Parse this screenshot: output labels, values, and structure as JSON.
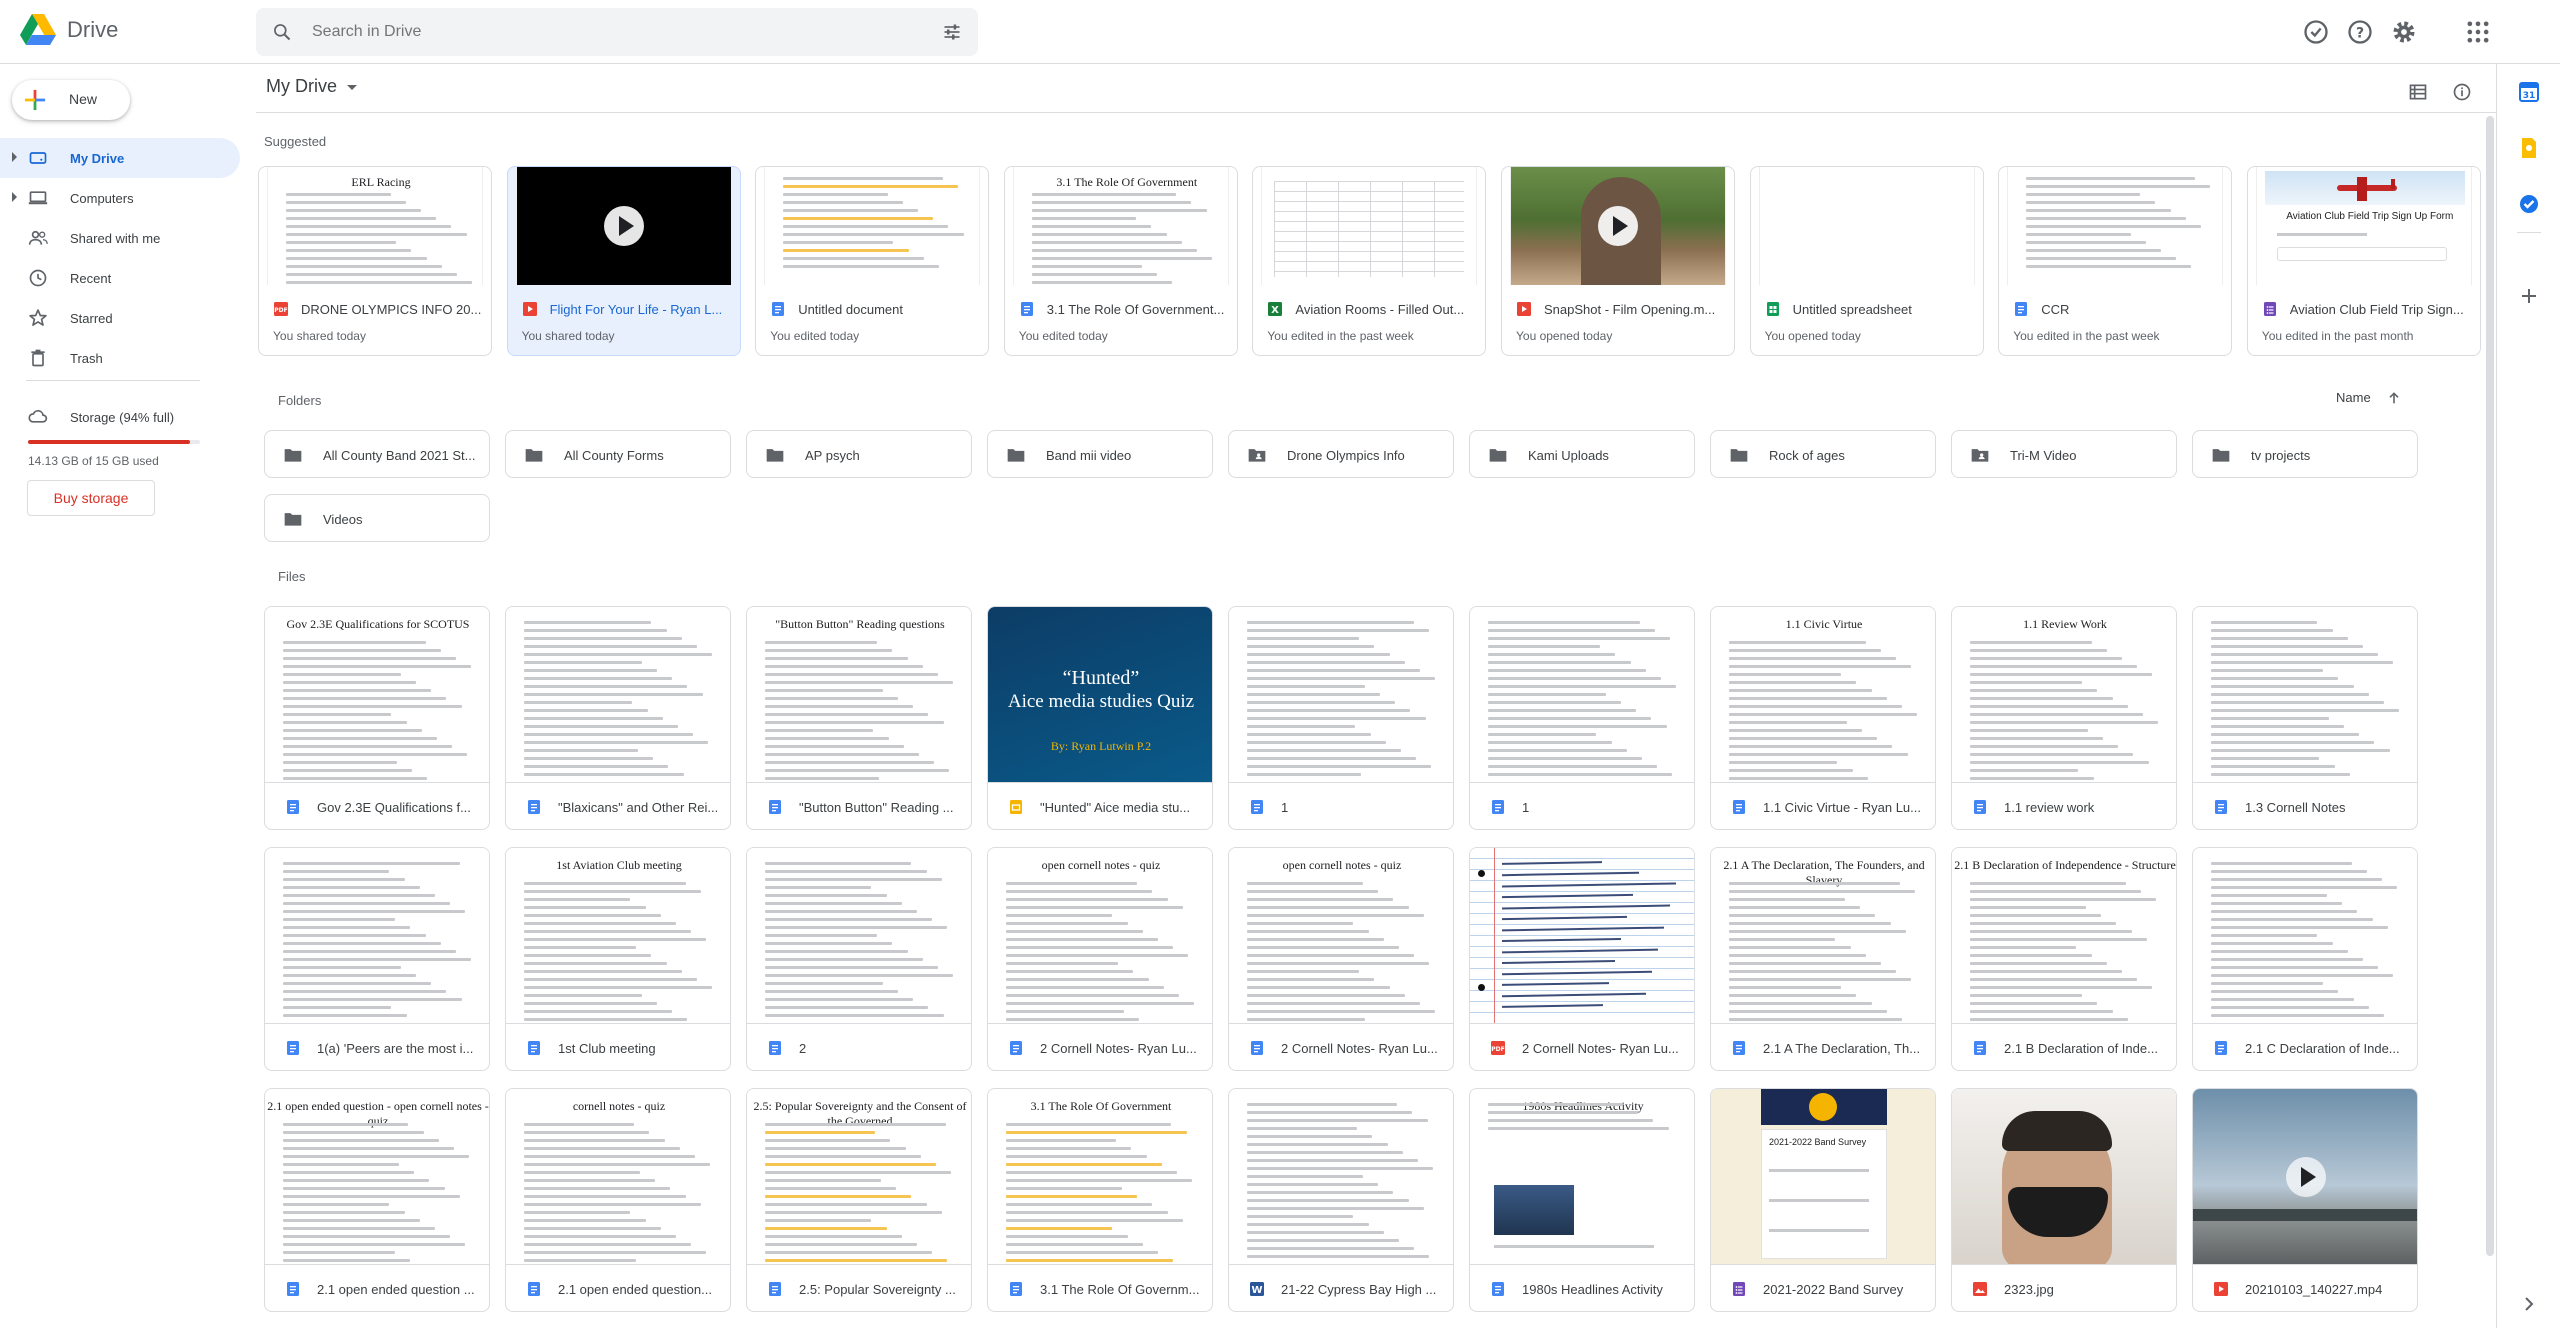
{
  "app": {
    "title": "Drive"
  },
  "search": {
    "placeholder": "Search in Drive"
  },
  "sidebar": {
    "new_label": "New",
    "items": [
      {
        "label": "My Drive",
        "icon": "my-drive-icon",
        "active": true
      },
      {
        "label": "Computers",
        "icon": "computers-icon"
      },
      {
        "label": "Shared with me",
        "icon": "shared-icon"
      },
      {
        "label": "Recent",
        "icon": "clock-icon"
      },
      {
        "label": "Starred",
        "icon": "star-icon"
      },
      {
        "label": "Trash",
        "icon": "trash-icon"
      }
    ],
    "storage": {
      "label": "Storage (94% full)",
      "used": "14.13 GB of 15 GB used",
      "fraction": 0.94,
      "buy_label": "Buy storage"
    }
  },
  "main": {
    "breadcrumb": "My Drive",
    "suggested_label": "Suggested",
    "folders_label": "Folders",
    "files_label": "Files",
    "sort_label": "Name"
  },
  "suggested": [
    {
      "name": "DRONE OLYMPICS INFO 20...",
      "sub": "You shared today",
      "type": "pdf",
      "thumb": "doc",
      "thumb_title": "ERL Racing"
    },
    {
      "name": "Flight For Your Life - Ryan L...",
      "sub": "You shared today",
      "type": "video",
      "thumb": "video-dark",
      "selected": true
    },
    {
      "name": "Untitled document",
      "sub": "You edited today",
      "type": "doc",
      "thumb": "doc-highlight"
    },
    {
      "name": "3.1 The Role Of Government...",
      "sub": "You edited today",
      "type": "doc",
      "thumb": "doc",
      "thumb_title": "3.1 The Role Of Government"
    },
    {
      "name": "Aviation Rooms - Filled Out...",
      "sub": "You edited in the past week",
      "type": "sheet-x",
      "thumb": "sheet"
    },
    {
      "name": "SnapShot - Film Opening.m...",
      "sub": "You opened today",
      "type": "video",
      "thumb": "video-tree"
    },
    {
      "name": "Untitled spreadsheet",
      "sub": "You opened today",
      "type": "sheet",
      "thumb": "blank"
    },
    {
      "name": "CCR",
      "sub": "You edited in the past week",
      "type": "doc",
      "thumb": "doc"
    },
    {
      "name": "Aviation Club Field Trip Sign...",
      "sub": "You edited in the past month",
      "type": "form",
      "thumb": "form-plane",
      "thumb_title": "Aviation Club Field Trip Sign Up Form"
    }
  ],
  "folders": [
    {
      "name": "All County Band 2021 St...",
      "shared": false
    },
    {
      "name": "All County Forms",
      "shared": false
    },
    {
      "name": "AP psych",
      "shared": false
    },
    {
      "name": "Band mii video",
      "shared": false
    },
    {
      "name": "Drone Olympics Info",
      "shared": true
    },
    {
      "name": "Kami Uploads",
      "shared": false
    },
    {
      "name": "Rock of ages",
      "shared": false
    },
    {
      "name": "Tri-M Video",
      "shared": true
    },
    {
      "name": "tv projects",
      "shared": false
    },
    {
      "name": "Videos",
      "shared": false
    }
  ],
  "files": [
    {
      "name": "Gov 2.3E Qualifications f...",
      "type": "doc",
      "thumb": "doc",
      "thumb_title": "Gov 2.3E Qualifications for SCOTUS"
    },
    {
      "name": "\"Blaxicans\" and Other Rei...",
      "type": "doc",
      "thumb": "doc"
    },
    {
      "name": "\"Button Button\" Reading ...",
      "type": "doc",
      "thumb": "doc",
      "thumb_title": "\"Button Button\" Reading questions"
    },
    {
      "name": "\"Hunted\" Aice media stu...",
      "type": "slides",
      "thumb": "slide-hunted",
      "slide_title_1": "“Hunted”",
      "slide_title_2": "Aice media studies Quiz",
      "slide_sub": "By: Ryan Lutwin P.2"
    },
    {
      "name": "1",
      "type": "doc",
      "thumb": "doc"
    },
    {
      "name": "1",
      "type": "doc",
      "thumb": "doc"
    },
    {
      "name": "1.1 Civic Virtue - Ryan Lu...",
      "type": "doc",
      "thumb": "doc",
      "thumb_title": "1.1 Civic Virtue"
    },
    {
      "name": "1.1 review work",
      "type": "doc",
      "thumb": "doc",
      "thumb_title": "1.1 Review Work"
    },
    {
      "name": "1.3 Cornell Notes",
      "type": "doc",
      "thumb": "doc"
    },
    {
      "name": "1(a) 'Peers are the most i...",
      "type": "doc",
      "thumb": "doc"
    },
    {
      "name": "1st Club meeting",
      "type": "doc",
      "thumb": "doc",
      "thumb_title": "1st Aviation Club meeting"
    },
    {
      "name": "2",
      "type": "doc",
      "thumb": "doc"
    },
    {
      "name": "2 Cornell Notes- Ryan Lu...",
      "type": "doc",
      "thumb": "doc",
      "thumb_title": "open cornell notes - quiz"
    },
    {
      "name": "2 Cornell Notes- Ryan Lu...",
      "type": "doc",
      "thumb": "doc",
      "thumb_title": "open cornell notes - quiz"
    },
    {
      "name": "2 Cornell Notes- Ryan Lu...",
      "type": "pdf",
      "thumb": "handwritten"
    },
    {
      "name": "2.1 A The Declaration, Th...",
      "type": "doc",
      "thumb": "doc",
      "thumb_title": "2.1 A The Declaration, The Founders, and Slavery"
    },
    {
      "name": "2.1 B Declaration of Inde...",
      "type": "doc",
      "thumb": "doc",
      "thumb_title": "2.1 B Declaration of Independence - Structure"
    },
    {
      "name": "2.1 C Declaration of Inde...",
      "type": "doc",
      "thumb": "doc"
    },
    {
      "name": "2.1 open ended question ...",
      "type": "doc",
      "thumb": "doc",
      "thumb_title": "2.1 open ended question - open cornell notes - quiz"
    },
    {
      "name": "2.1 open ended question...",
      "type": "doc",
      "thumb": "doc",
      "thumb_title": "cornell notes - quiz"
    },
    {
      "name": "2.5: Popular Sovereignty ...",
      "type": "doc",
      "thumb": "doc-highlight",
      "thumb_title": "2.5: Popular Sovereignty and the Consent of the Governed"
    },
    {
      "name": "3.1 The Role Of Governm...",
      "type": "doc",
      "thumb": "doc-highlight",
      "thumb_title": "3.1 The Role Of Government"
    },
    {
      "name": "21-22 Cypress Bay High ...",
      "type": "word",
      "thumb": "doc"
    },
    {
      "name": "1980s Headlines Activity",
      "type": "doc",
      "thumb": "doc-image",
      "thumb_title": "1980s Headlines Activity"
    },
    {
      "name": "2021-2022 Band Survey",
      "type": "form",
      "thumb": "form-band",
      "thumb_title": "2021-2022 Band Survey"
    },
    {
      "name": "2323.jpg",
      "type": "image",
      "thumb": "photo-mask"
    },
    {
      "name": "20210103_140227.mp4",
      "type": "video",
      "thumb": "photo-sky"
    }
  ],
  "colors": {
    "accent": "#1a73e8",
    "active_bg": "#e8f0fe",
    "danger": "#d93025",
    "doc_blue": "#4285f4",
    "sheet_green": "#0f9d58",
    "slides_yellow": "#f4b400",
    "form_purple": "#7248b9"
  }
}
